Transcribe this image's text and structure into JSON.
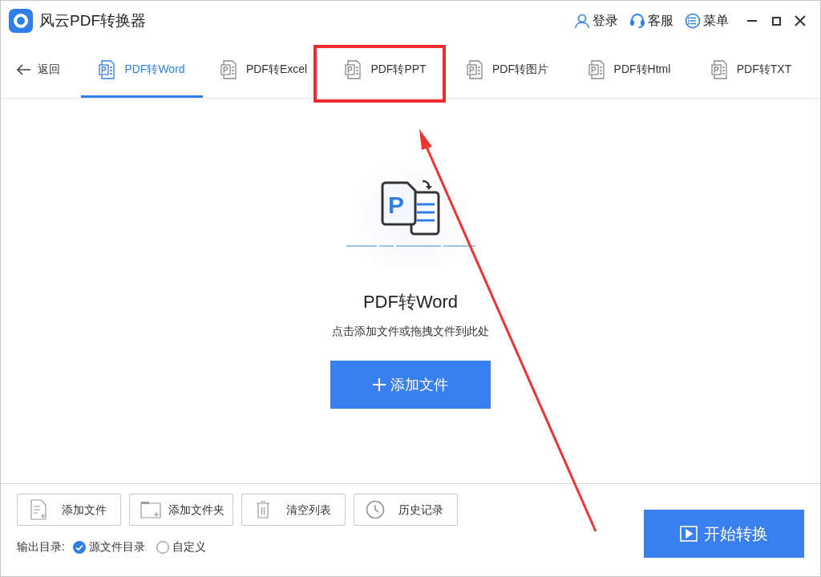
{
  "window": {
    "title": "风云PDF转换器",
    "actions": [
      {
        "kind": "user",
        "label": "登录"
      },
      {
        "kind": "headset",
        "label": "客服"
      },
      {
        "kind": "menu",
        "label": "菜单"
      }
    ]
  },
  "back": {
    "label": "返回"
  },
  "tabs": [
    {
      "icon_letter": "P",
      "label": "PDF转Word",
      "selected": true
    },
    {
      "icon_letter": "P",
      "label": "PDF转Excel",
      "selected": false
    },
    {
      "icon_letter": "P",
      "label": "PDF转PPT",
      "selected": false
    },
    {
      "icon_letter": "P",
      "label": "PDF转图片",
      "selected": false
    },
    {
      "icon_letter": "P",
      "label": "PDF转Html",
      "selected": false
    },
    {
      "icon_letter": "P",
      "label": "PDF转TXT",
      "selected": false
    }
  ],
  "drop_zone": {
    "icon_letter": "P",
    "title": "PDF转Word",
    "hint": "点击添加文件或拖拽文件到此处",
    "button": "添加文件"
  },
  "toolbar": [
    {
      "kind": "file",
      "label": "添加文件"
    },
    {
      "kind": "folder",
      "label": "添加文件夹"
    },
    {
      "kind": "trash",
      "label": "清空列表"
    },
    {
      "kind": "clock",
      "label": "历史记录"
    }
  ],
  "output": {
    "label": "输出目录:",
    "options": [
      {
        "label": "源文件目录",
        "selected": true
      },
      {
        "label": "自定义",
        "selected": false
      }
    ]
  },
  "start_button": "开始转换"
}
